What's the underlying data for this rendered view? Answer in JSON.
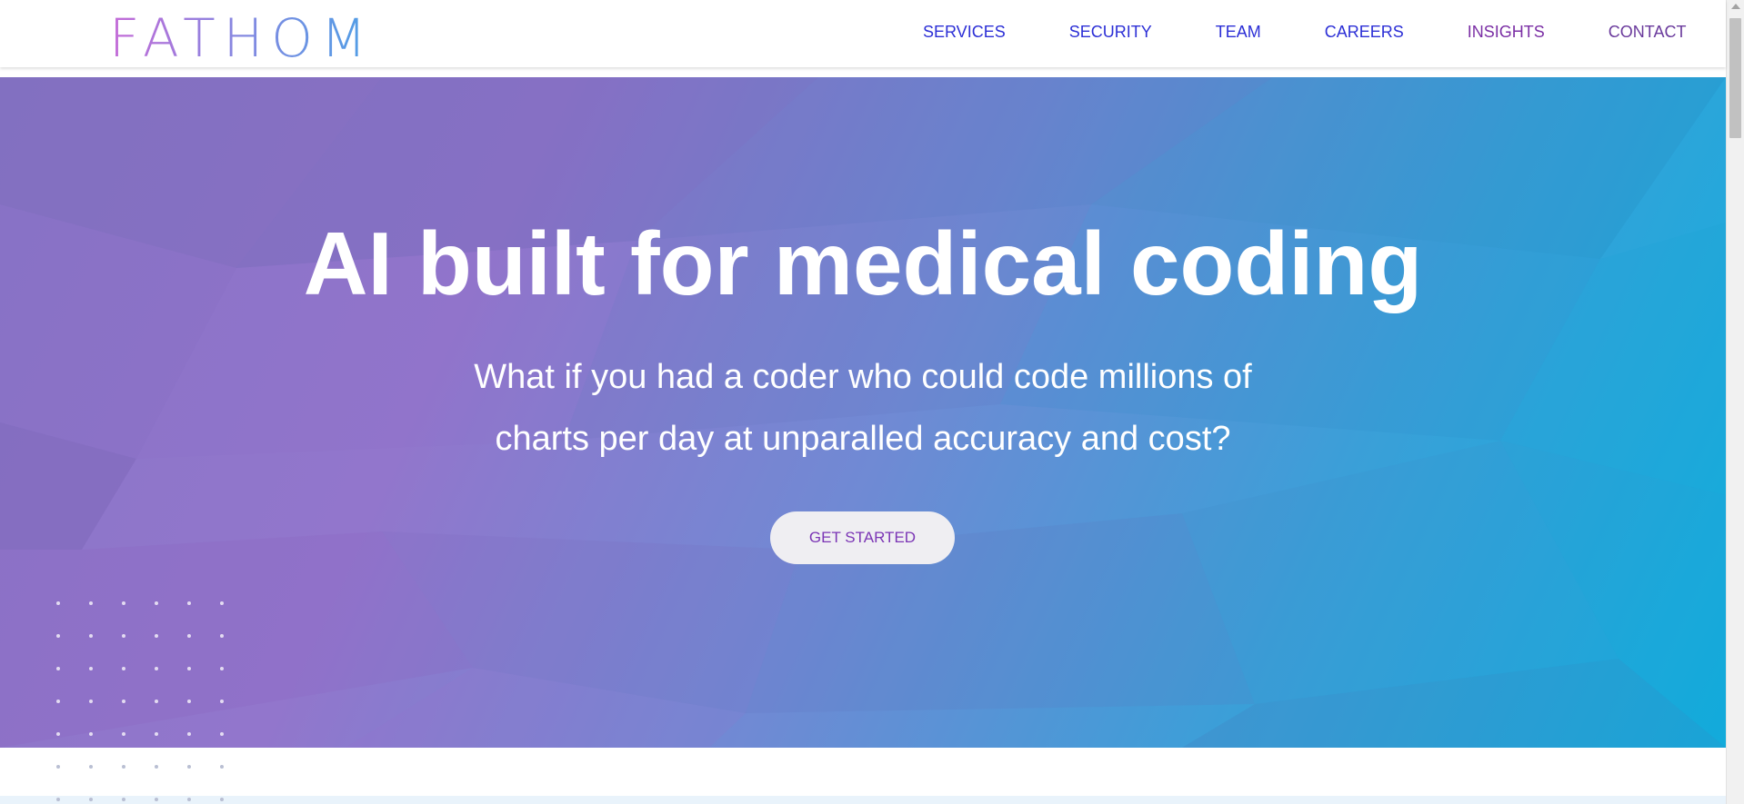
{
  "brand": {
    "logo_text": "FATHOM"
  },
  "nav": {
    "items": [
      {
        "label": "SERVICES"
      },
      {
        "label": "SECURITY"
      },
      {
        "label": "TEAM"
      },
      {
        "label": "CAREERS"
      },
      {
        "label": "INSIGHTS"
      },
      {
        "label": "CONTACT"
      }
    ]
  },
  "hero": {
    "title": "AI built for medical coding",
    "subtitle_line1": "What if you had a coder who could code millions of",
    "subtitle_line2": "charts per day at unparalled accuracy and cost?",
    "cta_label": "GET STARTED"
  },
  "colors": {
    "nav_link": "#2c2fd6",
    "nav_insights": "#7b2fa5",
    "hero_gradient_start": "#8a76c8",
    "hero_gradient_end": "#0fb0de",
    "cta_text": "#7b35b5",
    "cta_background": "#efeef2"
  }
}
